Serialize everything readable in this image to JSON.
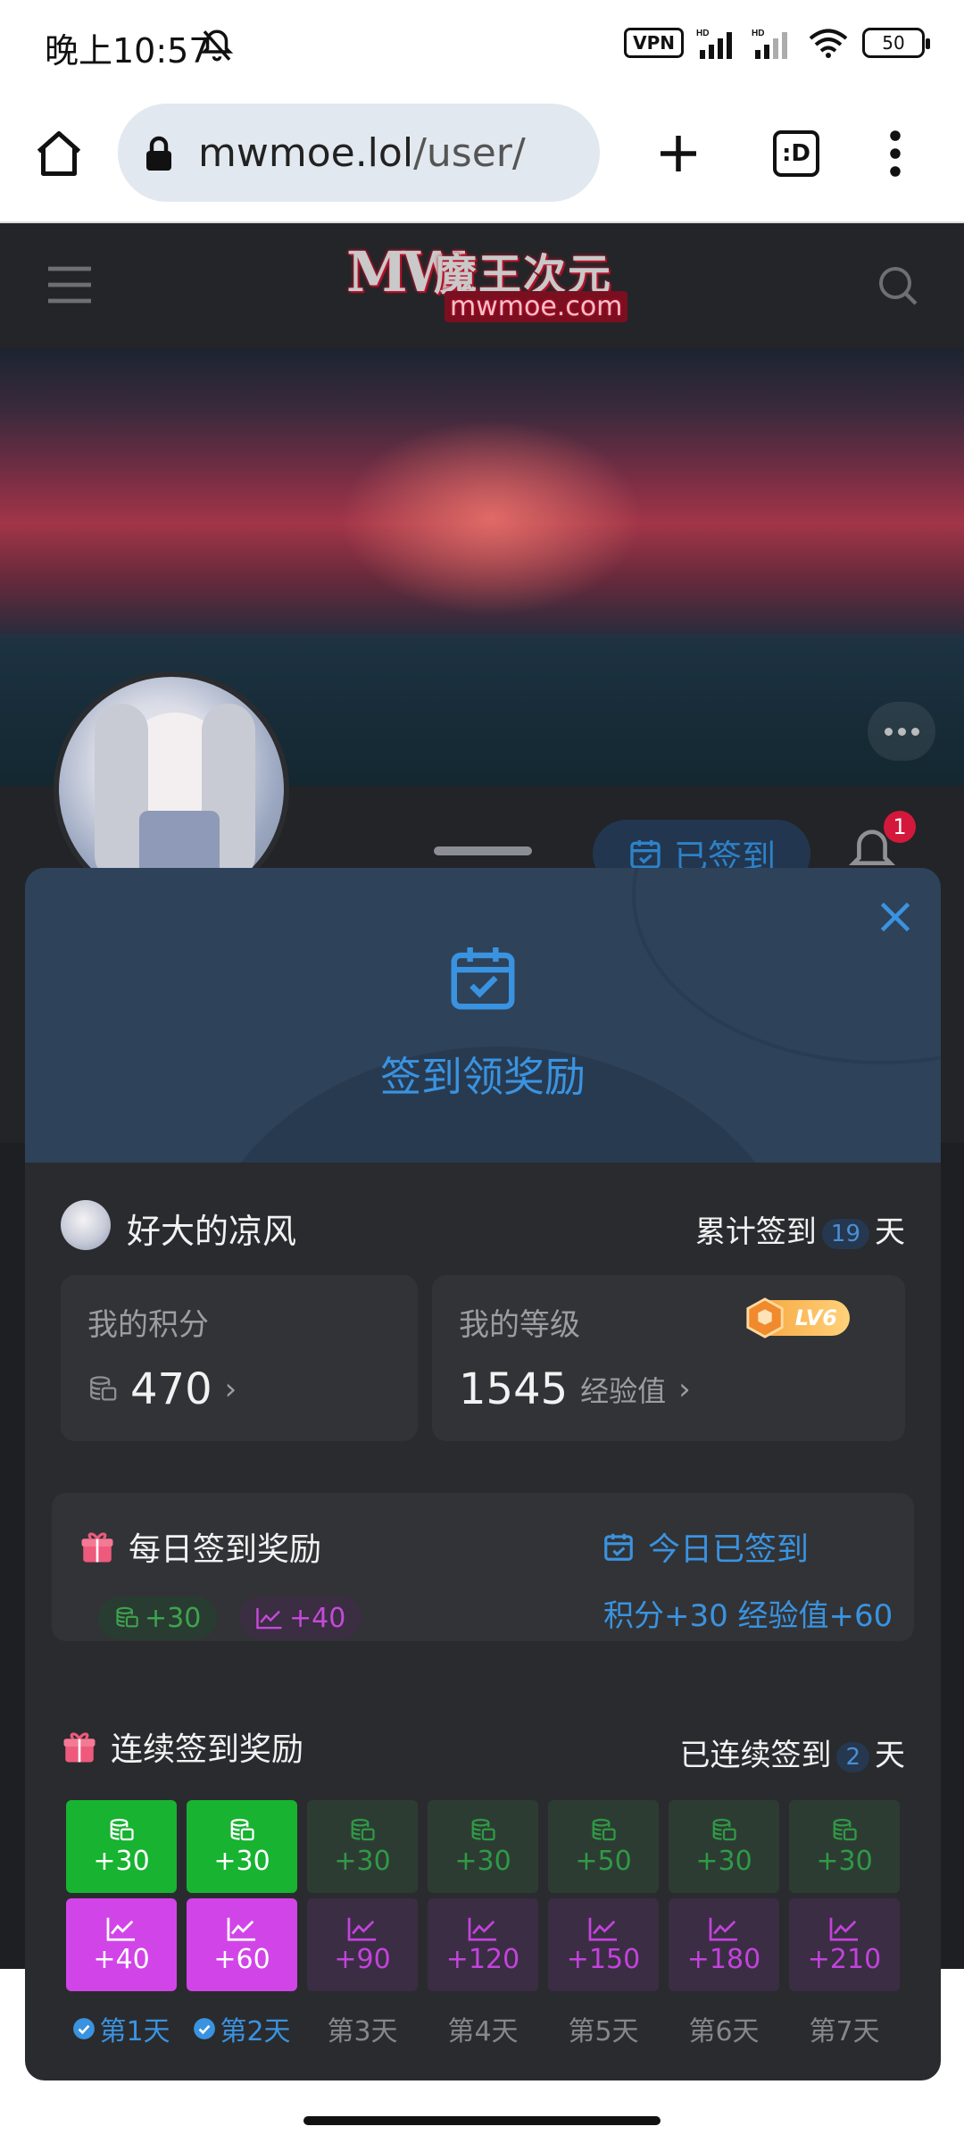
{
  "status_bar": {
    "time": "晚上10:57",
    "vpn": "VPN",
    "battery": "50",
    "icons": [
      "bell-off-icon",
      "signal-hd-icon",
      "signal-hd-icon",
      "wifi-icon",
      "battery-icon"
    ]
  },
  "browser": {
    "url_host": "mwmoe.lol",
    "url_path": "/user/",
    "tab_count_label": ":D"
  },
  "site": {
    "logo_mark": "MW",
    "logo_name": "魔王次元",
    "logo_domain": "mwmoe.com"
  },
  "profile": {
    "signed_button": "已签到",
    "notification_count": "1"
  },
  "modal": {
    "title": "签到领奖励",
    "username": "好大的凉风",
    "total_prefix": "累计签到",
    "total_days": "19",
    "total_suffix": "天",
    "points_label": "我的积分",
    "points_value": "470",
    "level_label": "我的等级",
    "level_badge": "LV6",
    "exp_value": "1545",
    "exp_unit": "经验值",
    "daily": {
      "title": "每日签到奖励",
      "points_chip": "+30",
      "exp_chip": "+40",
      "status": "今日已签到",
      "status_detail": "积分+30 经验值+60"
    },
    "streak": {
      "title": "连续签到奖励",
      "prefix": "已连续签到",
      "days": "2",
      "suffix": "天",
      "points": [
        "+30",
        "+30",
        "+30",
        "+30",
        "+50",
        "+30",
        "+30"
      ],
      "exp": [
        "+40",
        "+60",
        "+90",
        "+120",
        "+150",
        "+180",
        "+210"
      ],
      "day_labels": [
        "第1天",
        "第2天",
        "第3天",
        "第4天",
        "第5天",
        "第6天",
        "第7天"
      ],
      "completed": [
        true,
        true,
        false,
        false,
        false,
        false,
        false
      ]
    }
  },
  "colors": {
    "accent_blue": "#3a93e0",
    "points_green": "#17b331",
    "exp_purple": "#d145e8",
    "badge_red": "#d4183b"
  }
}
